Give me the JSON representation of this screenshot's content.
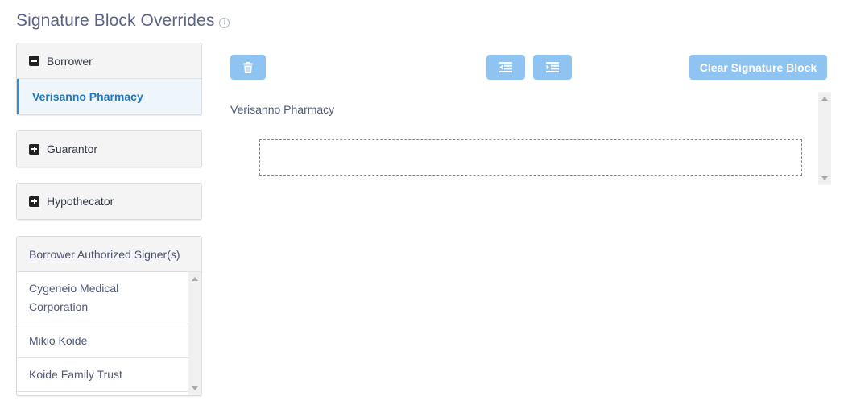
{
  "page": {
    "title": "Signature Block Overrides",
    "info_icon": "info-icon"
  },
  "sidebar": {
    "borrower": {
      "label": "Borrower",
      "icon": "minus-square-icon",
      "items": [
        {
          "label": "Verisanno Pharmacy",
          "selected": true
        }
      ]
    },
    "guarantor": {
      "label": "Guarantor",
      "icon": "plus-square-icon"
    },
    "hypothecator": {
      "label": "Hypothecator",
      "icon": "plus-square-icon"
    },
    "signers": {
      "label": "Borrower Authorized Signer(s)",
      "items": [
        {
          "label": "Cygeneio Medical Corporation"
        },
        {
          "label": "Mikio Koide"
        },
        {
          "label": "Koide Family Trust"
        }
      ]
    }
  },
  "toolbar": {
    "delete_icon": "trash-icon",
    "outdent_icon": "outdent-icon",
    "indent_icon": "indent-icon",
    "clear_label": "Clear Signature Block"
  },
  "editor": {
    "entity_name": "Verisanno Pharmacy",
    "signature_placeholder": ""
  },
  "colors": {
    "accent": "#2d8fd5",
    "button": "#8ec3f2",
    "selected_bg": "#eef6fb",
    "title": "#5a6385"
  }
}
